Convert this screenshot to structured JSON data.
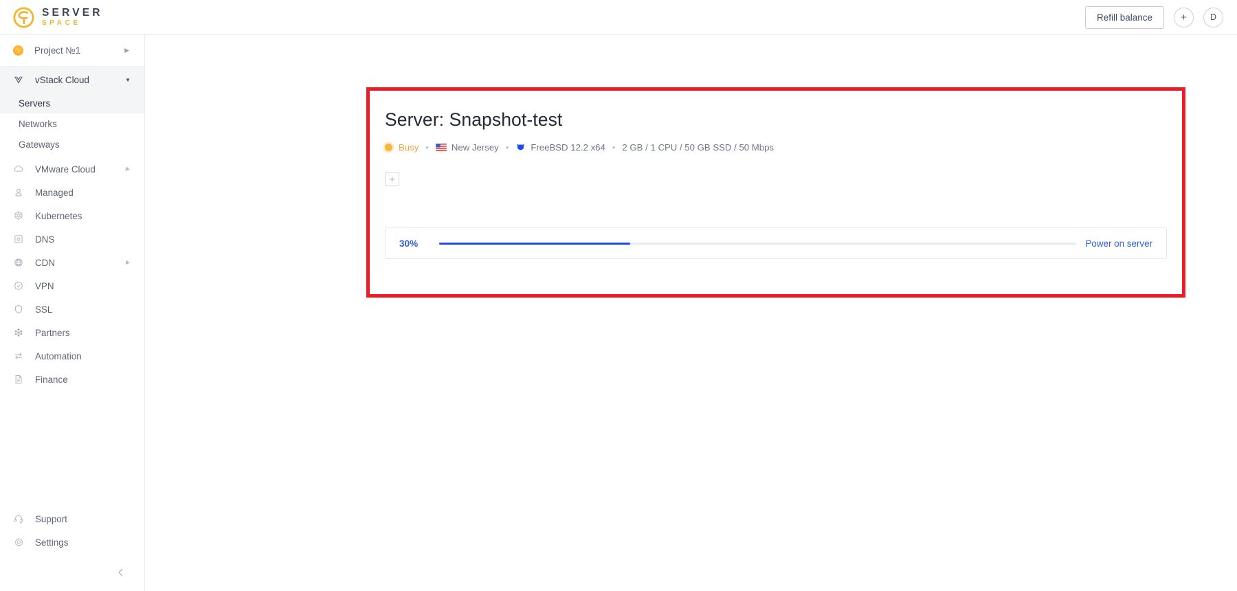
{
  "topbar": {
    "logo_primary": "SERVER",
    "logo_secondary": "SPACE",
    "refill_label": "Refill balance",
    "add_label": "+",
    "avatar_label": "D"
  },
  "sidebar": {
    "project": {
      "label": "Project №1"
    },
    "group": {
      "label": "vStack Cloud"
    },
    "sub_items": [
      {
        "label": "Servers",
        "active": true
      },
      {
        "label": "Networks",
        "active": false
      },
      {
        "label": "Gateways",
        "active": false
      }
    ],
    "items": [
      {
        "label": "VMware Cloud",
        "icon": "cloud-icon",
        "expandable": true
      },
      {
        "label": "Managed",
        "icon": "user-shield-icon",
        "expandable": false
      },
      {
        "label": "Kubernetes",
        "icon": "kubernetes-icon",
        "expandable": false
      },
      {
        "label": "DNS",
        "icon": "dns-icon",
        "expandable": false
      },
      {
        "label": "CDN",
        "icon": "globe-icon",
        "expandable": true
      },
      {
        "label": "VPN",
        "icon": "vpn-shield-icon",
        "expandable": false
      },
      {
        "label": "SSL",
        "icon": "shield-icon",
        "expandable": false
      },
      {
        "label": "Partners",
        "icon": "partners-icon",
        "expandable": false
      },
      {
        "label": "Automation",
        "icon": "automation-icon",
        "expandable": false
      },
      {
        "label": "Finance",
        "icon": "document-icon",
        "expandable": false
      }
    ],
    "bottom_items": [
      {
        "label": "Support",
        "icon": "headset-icon"
      },
      {
        "label": "Settings",
        "icon": "gear-icon"
      }
    ]
  },
  "main": {
    "title": "Server: Snapshot-test",
    "meta": {
      "status": "Busy",
      "location": "New Jersey",
      "os": "FreeBSD 12.2 x64",
      "specs": "2 GB / 1 CPU / 50 GB SSD / 50 Mbps",
      "separator": "•"
    },
    "add_tab_label": "+",
    "progress": {
      "percent_label": "30%",
      "percent_value": 30,
      "action_label": "Power on server"
    }
  },
  "colors": {
    "accent_blue": "#1b4cf0",
    "link_blue": "#2f5fe8",
    "brand_yellow": "#f5b32b",
    "status_orange": "#f6b93e",
    "highlight_red": "#ed1c24"
  }
}
